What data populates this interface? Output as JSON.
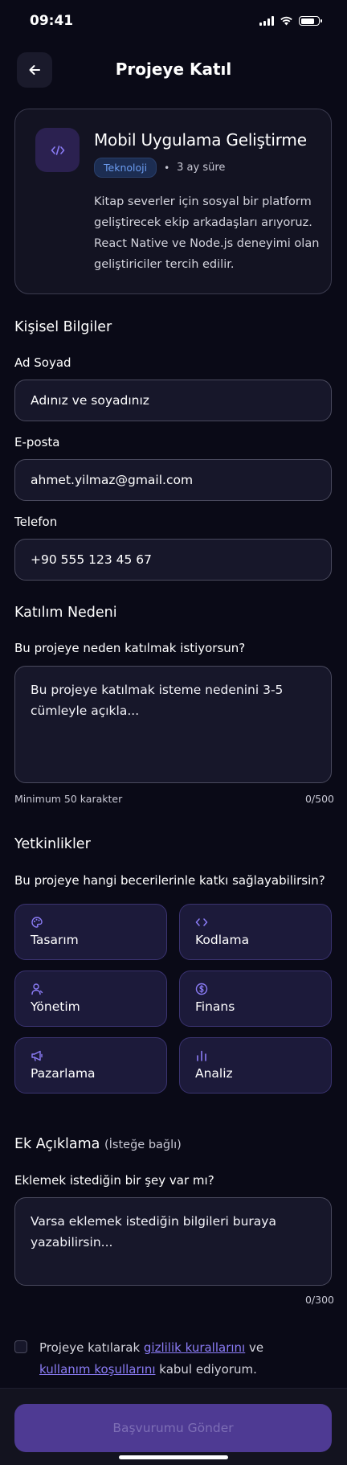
{
  "status_bar": {
    "time": "09:41"
  },
  "header": {
    "title": "Projeye Katıl"
  },
  "project": {
    "title": "Mobil Uygulama Geliştirme",
    "category": "Teknoloji",
    "separator": "•",
    "duration": "3 ay süre",
    "description": "Kitap severler için sosyal bir platform geliştirecek ekip arkadaşları arıyoruz. React Native ve Node.js deneyimi olan geliştiriciler tercih edilir.",
    "icon": "code-icon"
  },
  "personal": {
    "section_title": "Kişisel Bilgiler",
    "name_label": "Ad Soyad",
    "name_placeholder": "Adınız ve soyadınız",
    "email_label": "E-posta",
    "email_value": "ahmet.yilmaz@gmail.com",
    "phone_label": "Telefon",
    "phone_value": "+90 555 123 45 67"
  },
  "reason": {
    "section_title": "Katılım Nedeni",
    "question": "Bu projeye neden katılmak istiyorsun?",
    "placeholder": "Bu projeye katılmak isteme nedenini 3-5 cümleyle açıkla...",
    "min_hint": "Minimum 50 karakter",
    "counter": "0/500"
  },
  "skills": {
    "section_title": "Yetkinlikler",
    "question": "Bu projeye hangi becerilerinle katkı sağlayabilirsin?",
    "items": [
      {
        "label": "Tasarım",
        "icon": "palette-icon"
      },
      {
        "label": "Kodlama",
        "icon": "code-icon"
      },
      {
        "label": "Yönetim",
        "icon": "user-icon"
      },
      {
        "label": "Finans",
        "icon": "dollar-icon"
      },
      {
        "label": "Pazarlama",
        "icon": "megaphone-icon"
      },
      {
        "label": "Analiz",
        "icon": "bar-chart-icon"
      }
    ]
  },
  "extra": {
    "section_title": "Ek Açıklama",
    "optional": "(İsteğe bağlı)",
    "question": "Eklemek istediğin bir şey var mı?",
    "placeholder": "Varsa eklemek istediğin bilgileri buraya yazabilirsin...",
    "counter": "0/300"
  },
  "consent": {
    "prefix": "Projeye katılarak ",
    "privacy_link": "gizlilik kurallarını",
    "middle": " ve ",
    "terms_link": "kullanım koşullarını",
    "suffix": " kabul ediyorum."
  },
  "footer": {
    "submit_label": "Başvurumu Gönder"
  },
  "colors": {
    "accent": "#8b7cf6",
    "background": "#0a0a17",
    "badge_blue": "#6b9cf0"
  }
}
